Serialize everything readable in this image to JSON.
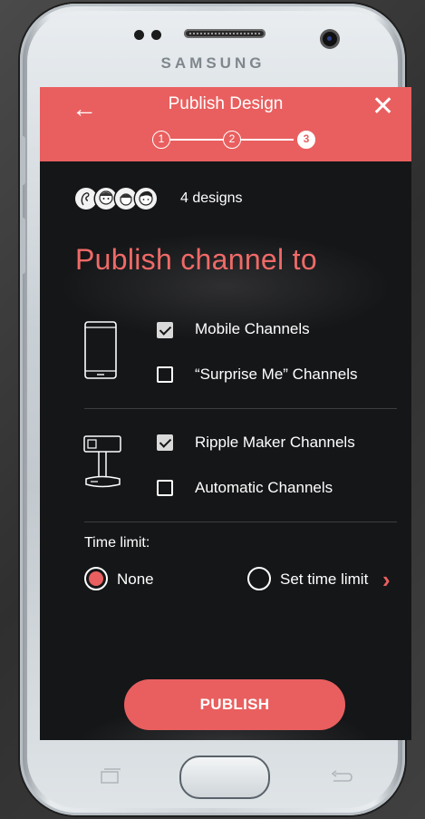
{
  "device": {
    "brand": "SAMSUNG"
  },
  "header": {
    "title": "Publish Design",
    "steps": [
      "1",
      "2",
      "3"
    ],
    "active_step": 3,
    "color": "#e95f5f"
  },
  "designs": {
    "count_label": "4 designs",
    "avatars": [
      "avatar-1",
      "avatar-2",
      "avatar-3",
      "avatar-4"
    ]
  },
  "section": {
    "heading": "Publish channel to"
  },
  "groups": [
    {
      "icon": "mobile-phone-icon",
      "options": [
        {
          "label": "Mobile Channels",
          "checked": true
        },
        {
          "label": "“Surprise Me” Channels",
          "checked": false
        }
      ]
    },
    {
      "icon": "ripple-maker-icon",
      "options": [
        {
          "label": "Ripple Maker Channels",
          "checked": true
        },
        {
          "label": "Automatic Channels",
          "checked": false
        }
      ]
    }
  ],
  "time_limit": {
    "label": "Time limit:",
    "options": [
      {
        "label": "None",
        "selected": true
      },
      {
        "label": "Set time limit",
        "selected": false
      }
    ]
  },
  "actions": {
    "publish_label": "PUBLISH"
  },
  "colors": {
    "accent": "#e95f5f",
    "background": "#151618",
    "text": "#ffffff"
  }
}
